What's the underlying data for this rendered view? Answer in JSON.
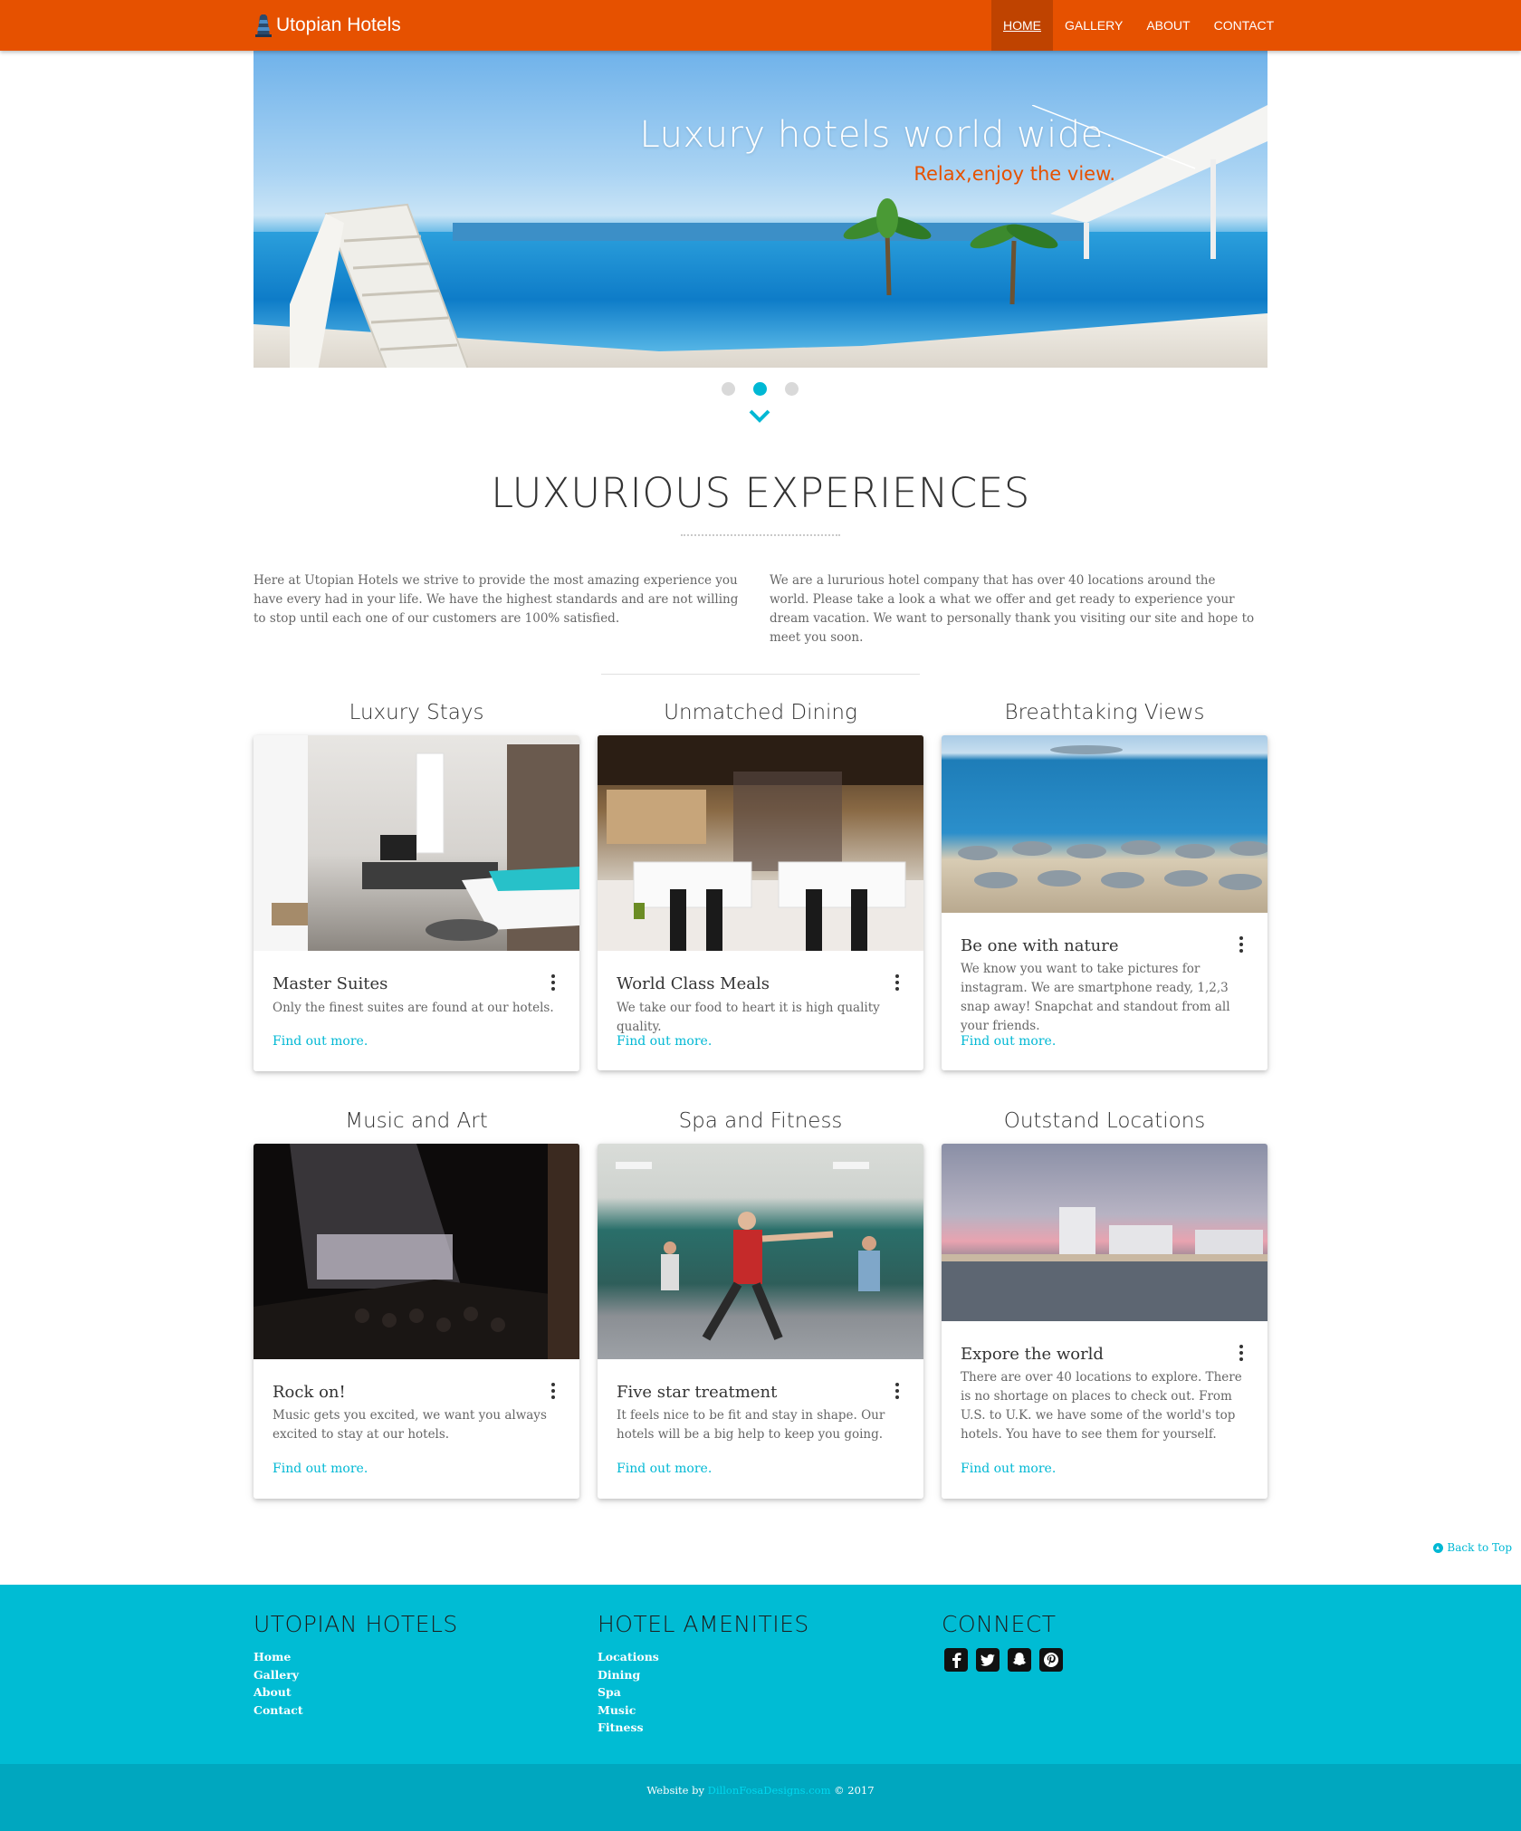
{
  "nav": {
    "brand": "Utopian Hotels",
    "links": [
      {
        "label": "HOME",
        "active": true
      },
      {
        "label": "GALLERY"
      },
      {
        "label": "ABOUT"
      },
      {
        "label": "CONTACT"
      }
    ]
  },
  "hero": {
    "title": "Luxury hotels world wide.",
    "subtitle": "Relax,enjoy the view.",
    "slide_count": 3,
    "active_slide": 2
  },
  "section": {
    "title": "LUXURIOUS EXPERIENCES",
    "intro_left": "Here at Utopian Hotels we strive to provide the most amazing experience you have every had in your life. We have the highest standards and are not willing to stop until each one of our customers are 100% satisfied.",
    "intro_right": "We are a lururious hotel company that has over 40 locations around the world. Please take a look a what we offer and get ready to experience your dream vacation. We want to personally thank you visiting our site and hope to meet you soon."
  },
  "cards": [
    {
      "title": "Luxury Stays",
      "heading": "Master Suites",
      "text": "Only the finest suites are found at our hotels.",
      "link": "Find out more."
    },
    {
      "title": "Unmatched Dining",
      "heading": "World Class Meals",
      "text": "We take our food to heart it is high quality quality.",
      "link": "Find out more."
    },
    {
      "title": "Breathtaking Views",
      "heading": "Be one with nature",
      "text": "We know you want to take pictures for instagram. We are smartphone ready, 1,2,3 snap away! Snapchat and standout from all your friends.",
      "link": "Find out more."
    },
    {
      "title": "Music and Art",
      "heading": "Rock on!",
      "text": "Music gets you excited, we want you always excited to stay at our hotels.",
      "link": "Find out more."
    },
    {
      "title": "Spa and Fitness",
      "heading": "Five star treatment",
      "text": "It feels nice to be fit and stay in shape. Our hotels will be a big help to keep you going.",
      "link": "Find out more."
    },
    {
      "title": "Outstand Locations",
      "heading": "Expore the world",
      "text": "There are over 40 locations to explore. There is no shortage on places to check out. From U.S. to U.K. we have some of the world's top hotels. You have to see them for yourself.",
      "link": "Find out more."
    }
  ],
  "back_to_top": "Back to Top",
  "footer": {
    "col1": {
      "heading": "UTOPIAN HOTELS",
      "links": [
        "Home",
        "Gallery",
        "About",
        "Contact"
      ]
    },
    "col2": {
      "heading": "HOTEL AMENITIES",
      "links": [
        "Locations",
        "Dining",
        "Spa",
        "Music",
        "Fitness"
      ]
    },
    "col3": {
      "heading": "CONNECT",
      "icons": [
        "facebook-icon",
        "twitter-icon",
        "snapchat-icon",
        "pinterest-icon"
      ]
    },
    "copyright_prefix": "Website by ",
    "copyright_link": "DillonFosaDesigns.com",
    "copyright_suffix": " © 2017"
  },
  "colors": {
    "nav": "#e65100",
    "accent": "#00bcd4",
    "link": "#00b8d4"
  }
}
